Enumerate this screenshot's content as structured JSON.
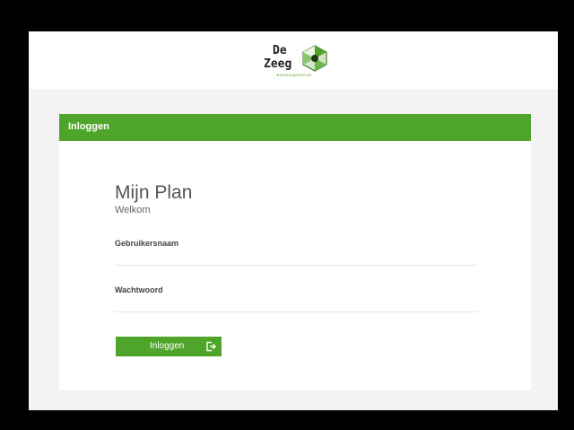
{
  "header": {
    "logo_line1": "De",
    "logo_line2": "Zeeg",
    "logo_sub": "woonzorgcentrum",
    "brand_color": "#4fa52a"
  },
  "panel": {
    "title": "Inloggen",
    "app_name": "Mijn Plan",
    "welcome": "Welkom"
  },
  "form": {
    "username_label": "Gebruikersnaam",
    "username_value": "",
    "password_label": "Wachtwoord",
    "password_value": "",
    "submit_label": "Inloggen",
    "submit_icon": "sign-in-icon"
  }
}
